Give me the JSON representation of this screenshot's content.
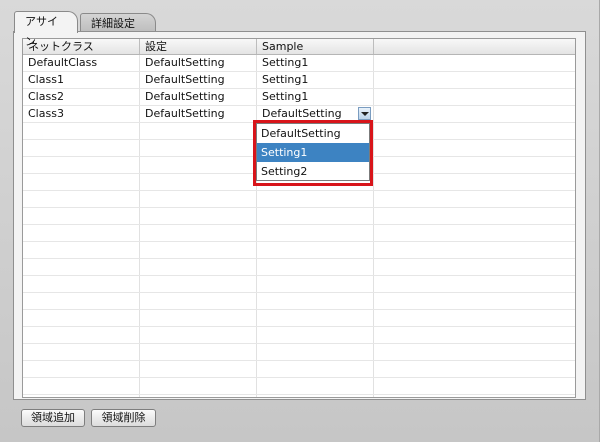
{
  "tabs": [
    {
      "label": "アサイン",
      "active": true
    },
    {
      "label": "詳細設定",
      "active": false
    }
  ],
  "table": {
    "columns": [
      "ネットクラス",
      "設定",
      "Sample",
      ""
    ],
    "rows": [
      [
        "DefaultClass",
        "DefaultSetting",
        "Setting1"
      ],
      [
        "Class1",
        "DefaultSetting",
        "Setting1"
      ],
      [
        "Class2",
        "DefaultSetting",
        "Setting1"
      ],
      [
        "Class3",
        "DefaultSetting",
        "DefaultSetting"
      ]
    ]
  },
  "dropdown": {
    "options": [
      "DefaultSetting",
      "Setting1",
      "Setting2"
    ],
    "selected": "Setting1"
  },
  "buttons": {
    "add_region": "領域追加",
    "delete_region": "領域削除"
  },
  "colors": {
    "highlight": "#d8141a",
    "selection": "#3d83c2"
  }
}
